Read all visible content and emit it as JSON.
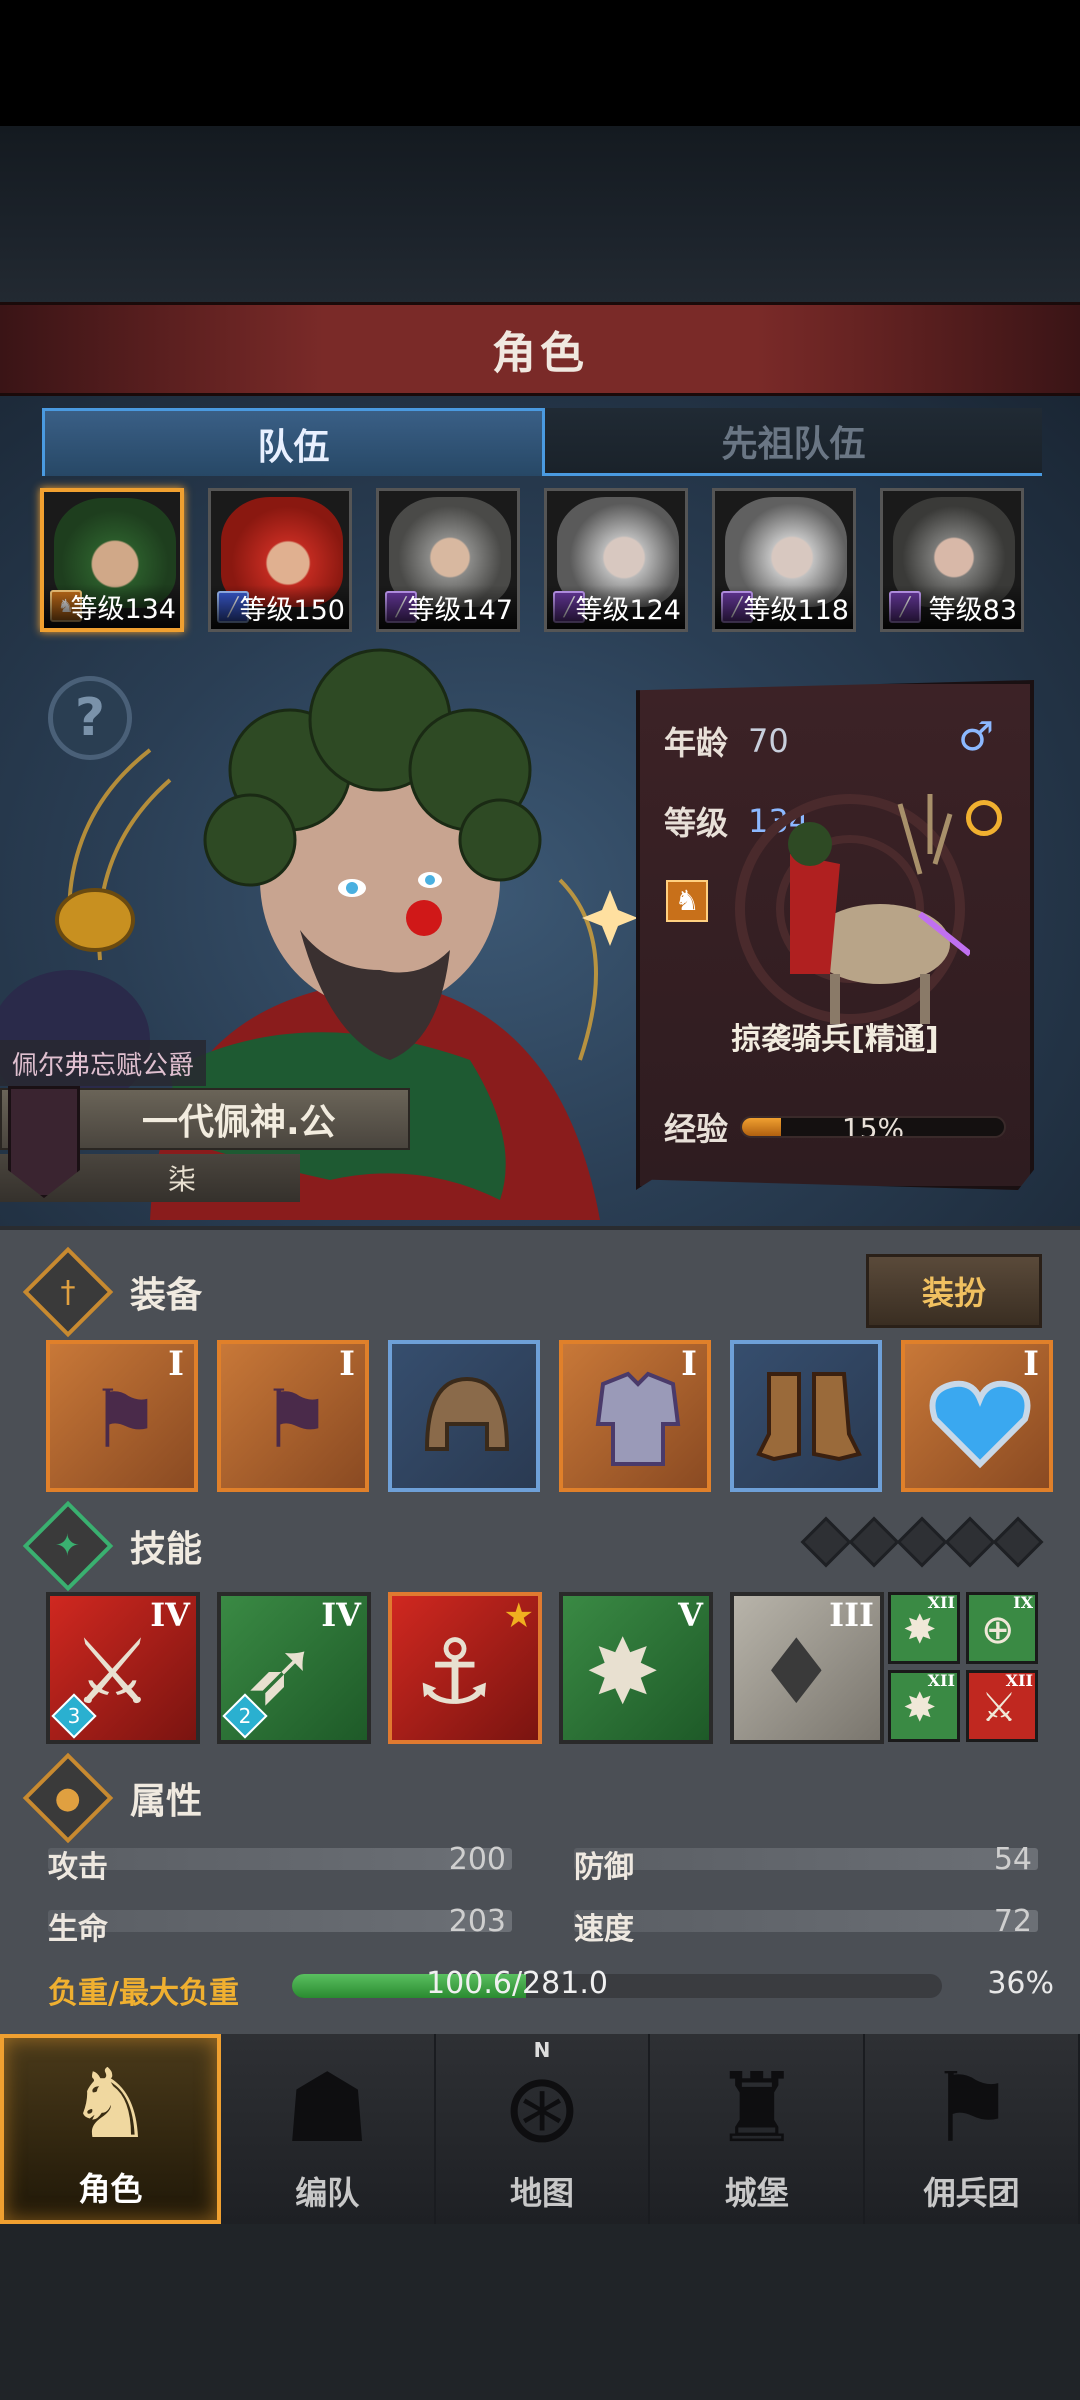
{
  "title": "角色",
  "tabs": [
    {
      "label": "队伍",
      "active": true
    },
    {
      "label": "先祖队伍",
      "active": false
    }
  ],
  "roster": [
    {
      "level": "等级134",
      "class_icon": "horse-icon",
      "selected": true
    },
    {
      "level": "等级150",
      "class_icon": "spear-icon",
      "selected": false
    },
    {
      "level": "等级147",
      "class_icon": "staff-icon",
      "selected": false
    },
    {
      "level": "等级124",
      "class_icon": "staff-icon",
      "selected": false
    },
    {
      "level": "等级118",
      "class_icon": "staff-icon",
      "selected": false
    },
    {
      "level": "等级83",
      "class_icon": "staff-icon",
      "selected": false
    }
  ],
  "help_icon": "?",
  "character": {
    "title": "佩尔弗忘赋公爵",
    "name": "一代佩神.公",
    "subtitle": "柒"
  },
  "stats": {
    "age_label": "年龄",
    "age": "70",
    "level_label": "等级",
    "level": "134",
    "gender_icon": "♂",
    "unit_name": "掠袭骑兵[精通]",
    "exp_label": "经验",
    "exp_pct": "15%",
    "exp_fraction": 0.15
  },
  "sections": {
    "equipment": "装备",
    "skills": "技能",
    "attributes": "属性"
  },
  "dress_button": "装扮",
  "equipment": [
    {
      "tier": "I",
      "icon": "banner-bow-icon",
      "quality": "orange"
    },
    {
      "tier": "I",
      "icon": "banner-bow-icon",
      "quality": "orange"
    },
    {
      "tier": "",
      "icon": "helmet-icon",
      "quality": "blue"
    },
    {
      "tier": "I",
      "icon": "armor-icon",
      "quality": "orange"
    },
    {
      "tier": "",
      "icon": "boots-icon",
      "quality": "blue"
    },
    {
      "tier": "I",
      "icon": "heart-amulet-icon",
      "quality": "orange"
    }
  ],
  "skills": [
    {
      "rank": "IV",
      "count": "3",
      "color": "red"
    },
    {
      "rank": "IV",
      "count": "2",
      "color": "green"
    },
    {
      "rank": "★",
      "count": "",
      "color": "redsel"
    },
    {
      "rank": "V",
      "count": "",
      "color": "green"
    },
    {
      "rank": "III",
      "count": "",
      "color": "grey"
    }
  ],
  "mini_skills": [
    {
      "rank": "XII",
      "color": "#3a8a44",
      "icon": "burst-icon"
    },
    {
      "rank": "IX",
      "color": "#3a8a44",
      "icon": "target-icon"
    },
    {
      "rank": "XII",
      "color": "#3a8a44",
      "icon": "burst-icon"
    },
    {
      "rank": "XII",
      "color": "#c02820",
      "icon": "sword-icon"
    }
  ],
  "attributes": {
    "attack_label": "攻击",
    "attack": "200",
    "defense_label": "防御",
    "defense": "54",
    "hp_label": "生命",
    "hp": "203",
    "speed_label": "速度",
    "speed": "72",
    "load_label": "负重/最大负重",
    "load": "100.6/281.0",
    "load_pct": "36%",
    "load_fraction": 0.36
  },
  "nav": [
    {
      "label": "角色",
      "icon": "knight-icon",
      "active": true
    },
    {
      "label": "编队",
      "icon": "helmet-icon",
      "active": false
    },
    {
      "label": "地图",
      "icon": "compass-icon",
      "active": false
    },
    {
      "label": "城堡",
      "icon": "castle-icon",
      "active": false
    },
    {
      "label": "佣兵团",
      "icon": "mercenary-icon",
      "active": false
    }
  ],
  "compass_letter": "N"
}
